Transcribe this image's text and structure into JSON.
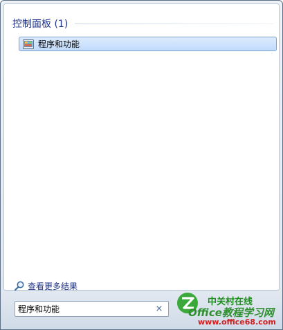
{
  "results": {
    "group_title": "控制面板 (1)",
    "items": [
      {
        "label": "程序和功能",
        "icon": "programs-and-features-icon"
      }
    ]
  },
  "see_more": {
    "label": "查看更多结果",
    "icon": "search-icon"
  },
  "search": {
    "value": "程序和功能",
    "clear_symbol": "×"
  },
  "watermark": {
    "line1": "中关村在线",
    "line2": "Office教程学习网",
    "line3": "www.office68.com"
  },
  "colors": {
    "group_title": "#1e3287",
    "selection": "#c1dbfc",
    "link": "#1e3287"
  }
}
